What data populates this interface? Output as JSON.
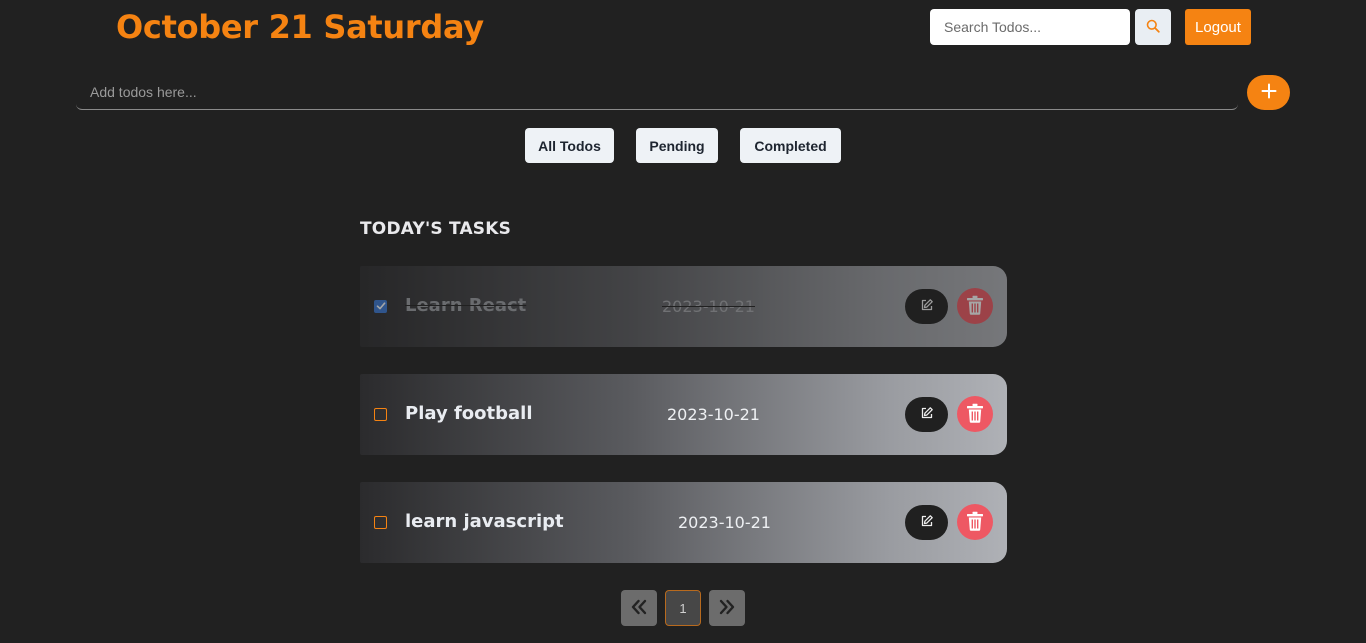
{
  "header": {
    "date_title": "October 21 Saturday",
    "search_placeholder": "Search Todos...",
    "logout_label": "Logout"
  },
  "add": {
    "placeholder": "Add todos here..."
  },
  "filters": {
    "all": "All Todos",
    "pending": "Pending",
    "completed": "Completed"
  },
  "section_title": "TODAY'S TASKS",
  "tasks": [
    {
      "title": "Learn React",
      "date": "2023-10-21",
      "completed": true
    },
    {
      "title": "Play football",
      "date": "2023-10-21",
      "completed": false
    },
    {
      "title": "learn javascript",
      "date": "2023-10-21",
      "completed": false
    }
  ],
  "pagination": {
    "current_page": "1"
  },
  "colors": {
    "accent": "#f58312",
    "background": "#212121",
    "delete": "#ee5863",
    "checkbox_checked": "#3a78d4"
  },
  "icons": {
    "search": "search-icon",
    "add": "plus-icon",
    "edit": "edit-icon",
    "delete": "trash-icon",
    "prev": "double-chevron-left-icon",
    "next": "double-chevron-right-icon",
    "check": "check-icon"
  }
}
